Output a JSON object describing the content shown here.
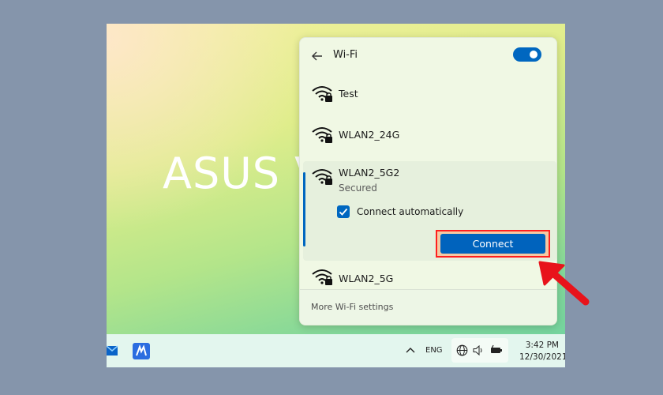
{
  "desktop": {
    "brand_text": "ASUS V"
  },
  "wifi_flyout": {
    "title": "Wi-Fi",
    "toggle_on": true,
    "accent_color": "#0067c0",
    "networks": [
      {
        "name": "Test",
        "icon": "wifi-secured-icon"
      },
      {
        "name": "WLAN2_24G",
        "icon": "wifi-secured-icon"
      },
      {
        "name": "WLAN2_5G2",
        "icon": "wifi-secured-icon",
        "status": "Secured",
        "selected": true
      },
      {
        "name": "WLAN2_5G",
        "icon": "wifi-secured-icon"
      }
    ],
    "connect_automatically_label": "Connect automatically",
    "connect_automatically_checked": true,
    "connect_label": "Connect",
    "more_settings_label": "More Wi-Fi settings"
  },
  "taskbar": {
    "language": "ENG",
    "time": "3:42 PM",
    "date": "12/30/2021"
  },
  "annotation": {
    "arrow_color": "#ff1e1e"
  }
}
